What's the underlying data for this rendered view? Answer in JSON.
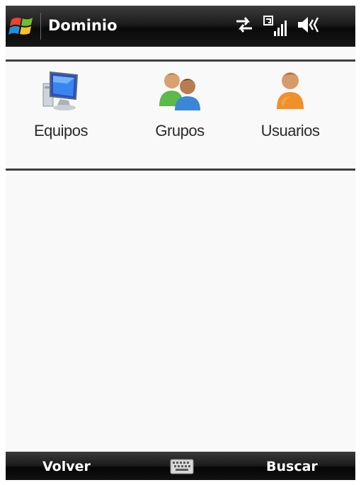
{
  "title_bar": {
    "title": "Dominio",
    "icons": [
      "windows-start-icon",
      "sync-arrows-icon",
      "signal-strength-icon",
      "speaker-volume-icon"
    ]
  },
  "tiles": [
    {
      "label": "Equipos",
      "icon": "computer-icon"
    },
    {
      "label": "Grupos",
      "icon": "group-users-icon"
    },
    {
      "label": "Usuarios",
      "icon": "user-icon"
    }
  ],
  "softkeys": {
    "left": "Volver",
    "center_icon": "keyboard-icon",
    "right": "Buscar"
  },
  "colors": {
    "bar_dark": "#111111",
    "content_bg": "#f9f9f9",
    "rule": "#3f3f3f",
    "label_text": "#2a2a2a"
  }
}
